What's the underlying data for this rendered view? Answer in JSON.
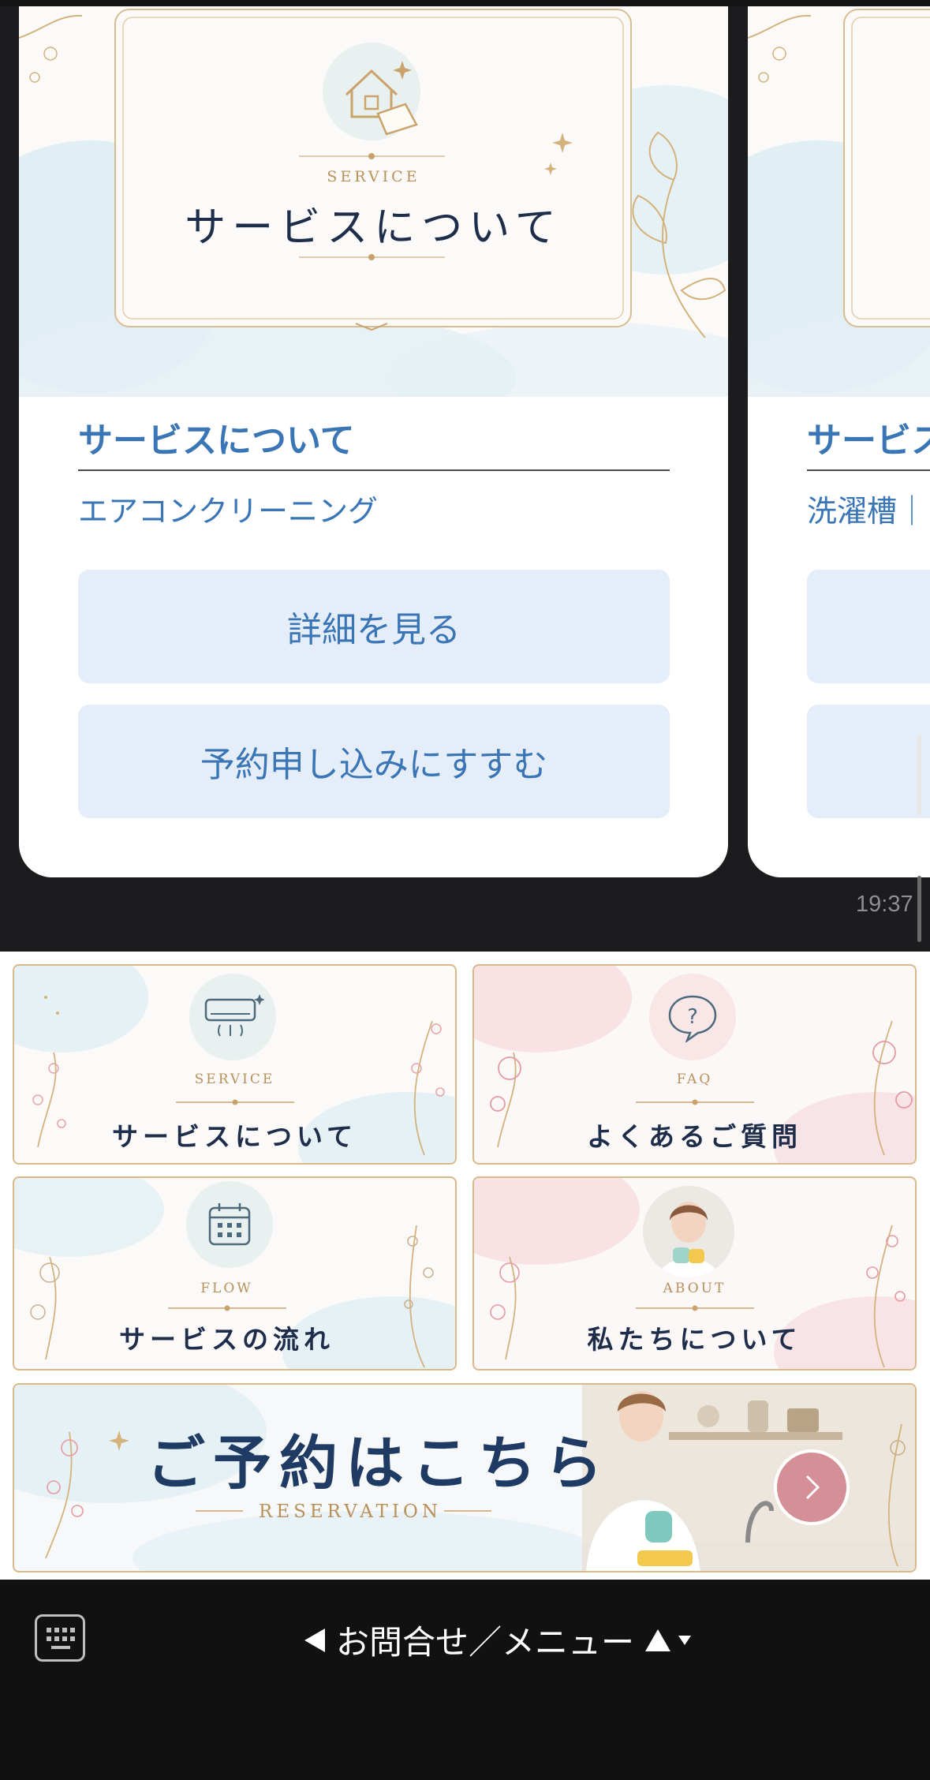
{
  "chat": {
    "cards": [
      {
        "image_eyebrow": "SERVICE",
        "image_title": "サービスについて",
        "title": "サービスについて",
        "subtitle": "エアコンクリーニング",
        "button_details": "詳細を見る",
        "button_reserve": "予約申し込みにすすむ"
      },
      {
        "title": "サービスについて",
        "subtitle": "洗濯槽｜"
      }
    ],
    "timestamp": "19:37"
  },
  "richmenu": {
    "tiles": [
      {
        "eyebrow": "SERVICE",
        "label": "サービスについて",
        "icon": "air-conditioner-icon"
      },
      {
        "eyebrow": "FAQ",
        "label": "よくあるご質問",
        "icon": "question-bubble-icon"
      },
      {
        "eyebrow": "FLOW",
        "label": "サービスの流れ",
        "icon": "calendar-icon"
      },
      {
        "eyebrow": "ABOUT",
        "label": "私たちについて",
        "icon": "staff-photo"
      }
    ],
    "reservation": {
      "title": "ご予約はこちら",
      "subtitle": "RESERVATION"
    }
  },
  "bottombar": {
    "menu_label": "お問合せ／メニュー"
  },
  "colors": {
    "accent_blue": "#3a76b6",
    "button_bg": "#e5eef8",
    "gold": "#b8905a",
    "navy": "#1d2d4a",
    "pink_button": "#d48f97"
  }
}
